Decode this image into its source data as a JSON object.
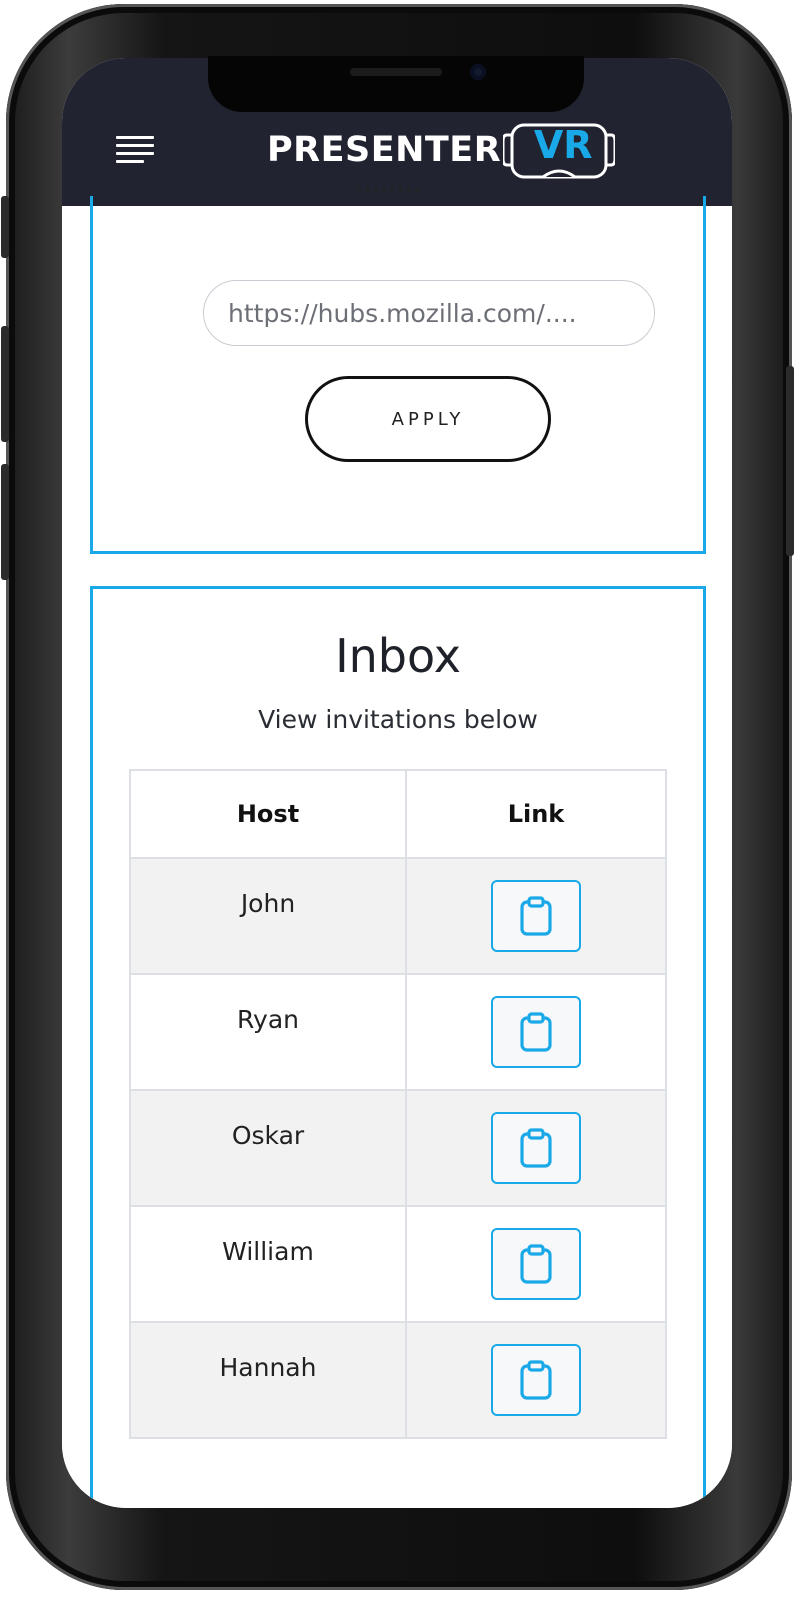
{
  "header": {
    "brand_text": "PRESENTER",
    "brand_badge": "VR",
    "colors": {
      "header_bg": "#212430",
      "accent": "#1aa9e8"
    },
    "menu_icon": "hamburger-menu-icon"
  },
  "top_card": {
    "cut_off_text": "........",
    "url_input": {
      "placeholder": "https://hubs.mozilla.com/....",
      "value": ""
    },
    "apply_label": "APPLY"
  },
  "inbox": {
    "title": "Inbox",
    "subtitle": "View invitations below",
    "columns": [
      "Host",
      "Link"
    ],
    "rows": [
      {
        "host": "John",
        "link_icon": "clipboard-icon"
      },
      {
        "host": "Ryan",
        "link_icon": "clipboard-icon"
      },
      {
        "host": "Oskar",
        "link_icon": "clipboard-icon"
      },
      {
        "host": "William",
        "link_icon": "clipboard-icon"
      },
      {
        "host": "Hannah",
        "link_icon": "clipboard-icon"
      }
    ]
  }
}
